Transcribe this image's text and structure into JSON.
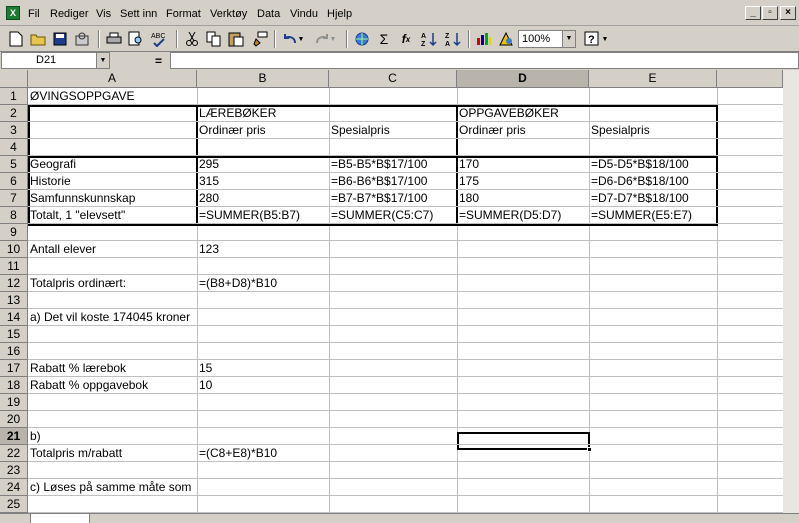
{
  "menubar": {
    "items": [
      "Fil",
      "Rediger",
      "Vis",
      "Sett inn",
      "Format",
      "Verktøy",
      "Data",
      "Vindu",
      "Hjelp"
    ],
    "window_buttons": [
      "_",
      "▫",
      "×"
    ]
  },
  "toolbar": {
    "zoom": "100%",
    "buttons": [
      "new-icon",
      "open-icon",
      "save-icon",
      "permission-icon",
      "print-icon",
      "print-preview-icon",
      "spellcheck-icon",
      "cut-icon",
      "copy-icon",
      "paste-icon",
      "format-painter-icon",
      "undo-icon",
      "redo-icon",
      "hyperlink-icon",
      "autosum-icon",
      "function-icon",
      "sort-ascending-icon",
      "sort-descending-icon",
      "chart-wizard-icon",
      "drawing-icon",
      "help-icon"
    ]
  },
  "formulabar": {
    "namebox": "D21",
    "equals": "=",
    "formula": ""
  },
  "grid": {
    "columns": [
      "A",
      "B",
      "C",
      "D",
      "E"
    ],
    "active_column": "D",
    "active_row": "21",
    "rows": [
      "1",
      "2",
      "3",
      "4",
      "5",
      "6",
      "7",
      "8",
      "9",
      "10",
      "11",
      "12",
      "13",
      "14",
      "15",
      "16",
      "17",
      "18",
      "19",
      "20",
      "21",
      "22",
      "23",
      "24",
      "25"
    ],
    "cells": {
      "A1": "ØVINGSOPPGAVE",
      "B2": "LÆREBØKER",
      "D2": "OPPGAVEBØKER",
      "B3": "Ordinær pris",
      "C3": "Spesialpris",
      "D3": "Ordinær pris",
      "E3": "Spesialpris",
      "A5": "Geografi",
      "B5": "295",
      "C5": "=B5-B5*B$17/100",
      "D5": "170",
      "E5": "=D5-D5*B$18/100",
      "A6": "Historie",
      "B6": "315",
      "C6": "=B6-B6*B$17/100",
      "D6": "175",
      "E6": "=D6-D6*B$18/100",
      "A7": "Samfunnskunnskap",
      "B7": "280",
      "C7": "=B7-B7*B$17/100",
      "D7": "180",
      "E7": "=D7-D7*B$18/100",
      "A8": "Totalt, 1 \"elevsett\"",
      "B8": "=SUMMER(B5:B7)",
      "C8": "=SUMMER(C5:C7)",
      "D8": "=SUMMER(D5:D7)",
      "E8": "=SUMMER(E5:E7)",
      "A10": "Antall elever",
      "B10": "123",
      "A12": "Totalpris ordinært:",
      "B12": "=(B8+D8)*B10",
      "A14": "a) Det vil koste 174045 kroner",
      "A17": "Rabatt % lærebok",
      "B17": "15",
      "A18": "Rabatt % oppgavebok",
      "B18": "10",
      "A21": "b)",
      "A22": "Totalpris m/rabatt",
      "B22": "=(C8+E8)*B10",
      "A24": "c) Løses på samme måte som"
    }
  }
}
